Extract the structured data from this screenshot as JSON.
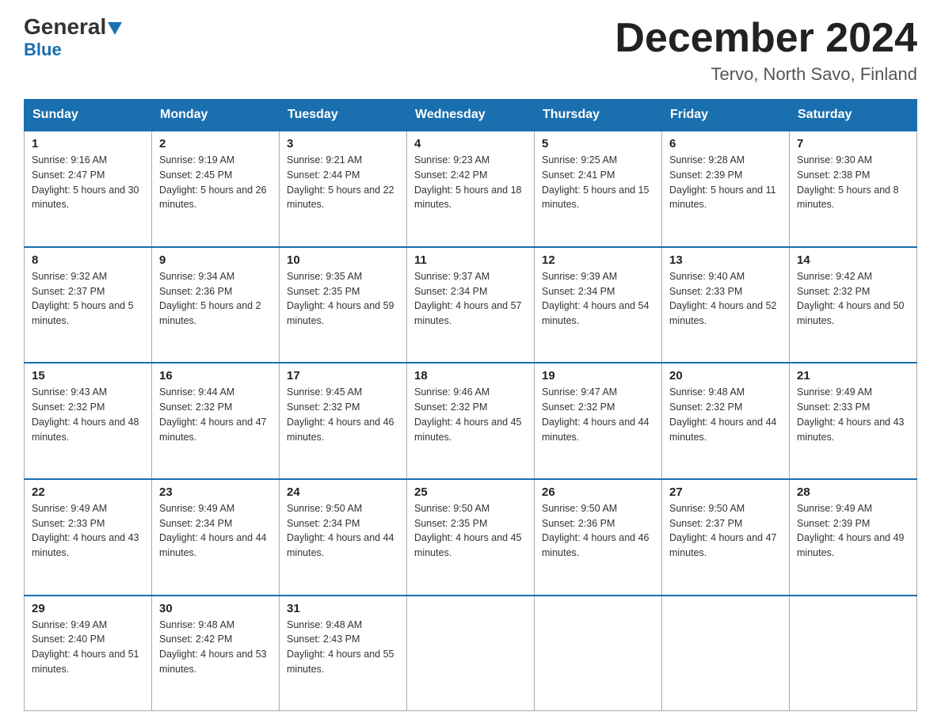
{
  "header": {
    "logo_main": "General",
    "logo_sub": "Blue",
    "month_title": "December 2024",
    "location": "Tervo, North Savo, Finland"
  },
  "days_of_week": [
    "Sunday",
    "Monday",
    "Tuesday",
    "Wednesday",
    "Thursday",
    "Friday",
    "Saturday"
  ],
  "weeks": [
    [
      {
        "day": "1",
        "sunrise": "Sunrise: 9:16 AM",
        "sunset": "Sunset: 2:47 PM",
        "daylight": "Daylight: 5 hours and 30 minutes."
      },
      {
        "day": "2",
        "sunrise": "Sunrise: 9:19 AM",
        "sunset": "Sunset: 2:45 PM",
        "daylight": "Daylight: 5 hours and 26 minutes."
      },
      {
        "day": "3",
        "sunrise": "Sunrise: 9:21 AM",
        "sunset": "Sunset: 2:44 PM",
        "daylight": "Daylight: 5 hours and 22 minutes."
      },
      {
        "day": "4",
        "sunrise": "Sunrise: 9:23 AM",
        "sunset": "Sunset: 2:42 PM",
        "daylight": "Daylight: 5 hours and 18 minutes."
      },
      {
        "day": "5",
        "sunrise": "Sunrise: 9:25 AM",
        "sunset": "Sunset: 2:41 PM",
        "daylight": "Daylight: 5 hours and 15 minutes."
      },
      {
        "day": "6",
        "sunrise": "Sunrise: 9:28 AM",
        "sunset": "Sunset: 2:39 PM",
        "daylight": "Daylight: 5 hours and 11 minutes."
      },
      {
        "day": "7",
        "sunrise": "Sunrise: 9:30 AM",
        "sunset": "Sunset: 2:38 PM",
        "daylight": "Daylight: 5 hours and 8 minutes."
      }
    ],
    [
      {
        "day": "8",
        "sunrise": "Sunrise: 9:32 AM",
        "sunset": "Sunset: 2:37 PM",
        "daylight": "Daylight: 5 hours and 5 minutes."
      },
      {
        "day": "9",
        "sunrise": "Sunrise: 9:34 AM",
        "sunset": "Sunset: 2:36 PM",
        "daylight": "Daylight: 5 hours and 2 minutes."
      },
      {
        "day": "10",
        "sunrise": "Sunrise: 9:35 AM",
        "sunset": "Sunset: 2:35 PM",
        "daylight": "Daylight: 4 hours and 59 minutes."
      },
      {
        "day": "11",
        "sunrise": "Sunrise: 9:37 AM",
        "sunset": "Sunset: 2:34 PM",
        "daylight": "Daylight: 4 hours and 57 minutes."
      },
      {
        "day": "12",
        "sunrise": "Sunrise: 9:39 AM",
        "sunset": "Sunset: 2:34 PM",
        "daylight": "Daylight: 4 hours and 54 minutes."
      },
      {
        "day": "13",
        "sunrise": "Sunrise: 9:40 AM",
        "sunset": "Sunset: 2:33 PM",
        "daylight": "Daylight: 4 hours and 52 minutes."
      },
      {
        "day": "14",
        "sunrise": "Sunrise: 9:42 AM",
        "sunset": "Sunset: 2:32 PM",
        "daylight": "Daylight: 4 hours and 50 minutes."
      }
    ],
    [
      {
        "day": "15",
        "sunrise": "Sunrise: 9:43 AM",
        "sunset": "Sunset: 2:32 PM",
        "daylight": "Daylight: 4 hours and 48 minutes."
      },
      {
        "day": "16",
        "sunrise": "Sunrise: 9:44 AM",
        "sunset": "Sunset: 2:32 PM",
        "daylight": "Daylight: 4 hours and 47 minutes."
      },
      {
        "day": "17",
        "sunrise": "Sunrise: 9:45 AM",
        "sunset": "Sunset: 2:32 PM",
        "daylight": "Daylight: 4 hours and 46 minutes."
      },
      {
        "day": "18",
        "sunrise": "Sunrise: 9:46 AM",
        "sunset": "Sunset: 2:32 PM",
        "daylight": "Daylight: 4 hours and 45 minutes."
      },
      {
        "day": "19",
        "sunrise": "Sunrise: 9:47 AM",
        "sunset": "Sunset: 2:32 PM",
        "daylight": "Daylight: 4 hours and 44 minutes."
      },
      {
        "day": "20",
        "sunrise": "Sunrise: 9:48 AM",
        "sunset": "Sunset: 2:32 PM",
        "daylight": "Daylight: 4 hours and 44 minutes."
      },
      {
        "day": "21",
        "sunrise": "Sunrise: 9:49 AM",
        "sunset": "Sunset: 2:33 PM",
        "daylight": "Daylight: 4 hours and 43 minutes."
      }
    ],
    [
      {
        "day": "22",
        "sunrise": "Sunrise: 9:49 AM",
        "sunset": "Sunset: 2:33 PM",
        "daylight": "Daylight: 4 hours and 43 minutes."
      },
      {
        "day": "23",
        "sunrise": "Sunrise: 9:49 AM",
        "sunset": "Sunset: 2:34 PM",
        "daylight": "Daylight: 4 hours and 44 minutes."
      },
      {
        "day": "24",
        "sunrise": "Sunrise: 9:50 AM",
        "sunset": "Sunset: 2:34 PM",
        "daylight": "Daylight: 4 hours and 44 minutes."
      },
      {
        "day": "25",
        "sunrise": "Sunrise: 9:50 AM",
        "sunset": "Sunset: 2:35 PM",
        "daylight": "Daylight: 4 hours and 45 minutes."
      },
      {
        "day": "26",
        "sunrise": "Sunrise: 9:50 AM",
        "sunset": "Sunset: 2:36 PM",
        "daylight": "Daylight: 4 hours and 46 minutes."
      },
      {
        "day": "27",
        "sunrise": "Sunrise: 9:50 AM",
        "sunset": "Sunset: 2:37 PM",
        "daylight": "Daylight: 4 hours and 47 minutes."
      },
      {
        "day": "28",
        "sunrise": "Sunrise: 9:49 AM",
        "sunset": "Sunset: 2:39 PM",
        "daylight": "Daylight: 4 hours and 49 minutes."
      }
    ],
    [
      {
        "day": "29",
        "sunrise": "Sunrise: 9:49 AM",
        "sunset": "Sunset: 2:40 PM",
        "daylight": "Daylight: 4 hours and 51 minutes."
      },
      {
        "day": "30",
        "sunrise": "Sunrise: 9:48 AM",
        "sunset": "Sunset: 2:42 PM",
        "daylight": "Daylight: 4 hours and 53 minutes."
      },
      {
        "day": "31",
        "sunrise": "Sunrise: 9:48 AM",
        "sunset": "Sunset: 2:43 PM",
        "daylight": "Daylight: 4 hours and 55 minutes."
      },
      null,
      null,
      null,
      null
    ]
  ]
}
